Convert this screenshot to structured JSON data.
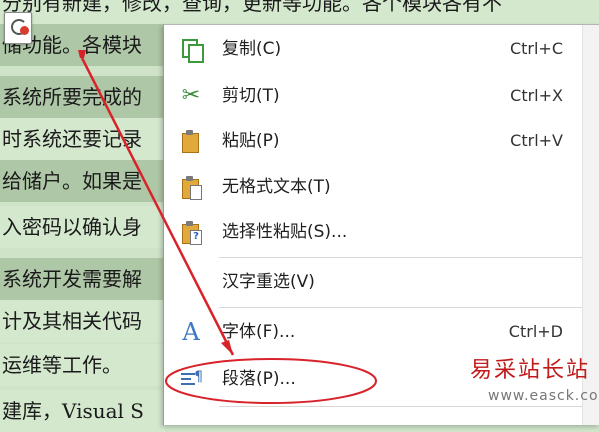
{
  "document": {
    "lines": [
      {
        "text": "分别有新建，修改，查询，更新等功能。各个模块各有不",
        "style": "plain"
      },
      {
        "text": "储功能。各模块",
        "style": "sel"
      },
      {
        "text": "系统所要完成的",
        "style": "sel"
      },
      {
        "text": "时系统还要记录",
        "style": "plain"
      },
      {
        "text": "给储户。如果是",
        "style": "sel"
      },
      {
        "text": "入密码以确认身",
        "style": "plain"
      },
      {
        "text": "系统开发需要解",
        "style": "sel"
      },
      {
        "text": "计及其相关代码",
        "style": "plain"
      },
      {
        "text": "运维等工作。",
        "style": "plain"
      },
      {
        "text": "建库，Visual S",
        "style": "plain"
      }
    ]
  },
  "menu": {
    "items": [
      {
        "label": "复制(C)",
        "shortcut": "Ctrl+C",
        "icon": "copy-icon"
      },
      {
        "label": "剪切(T)",
        "shortcut": "Ctrl+X",
        "icon": "scissors-icon"
      },
      {
        "label": "粘贴(P)",
        "shortcut": "Ctrl+V",
        "icon": "paste-icon"
      },
      {
        "label": "无格式文本(T)",
        "shortcut": "",
        "icon": "paste-text-icon"
      },
      {
        "label": "选择性粘贴(S)...",
        "shortcut": "",
        "icon": "paste-special-icon"
      },
      {
        "label": "汉字重选(V)",
        "shortcut": "",
        "icon": ""
      },
      {
        "label": "字体(F)...",
        "shortcut": "Ctrl+D",
        "icon": "font-icon"
      },
      {
        "label": "段落(P)...",
        "shortcut": "",
        "icon": "paragraph-icon"
      }
    ]
  },
  "annotation": {
    "color": "#d8232a"
  },
  "watermark": {
    "name": "易采站长站",
    "url": "www.easck.com"
  }
}
